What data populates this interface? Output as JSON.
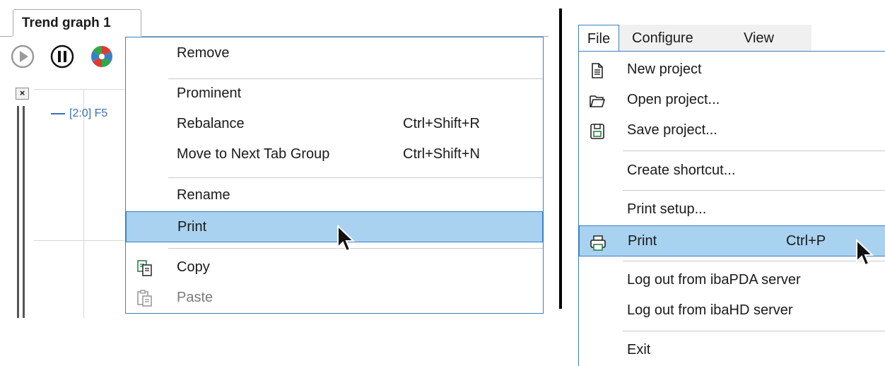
{
  "left_panel": {
    "tab_title": "Trend graph 1",
    "close_glyph": "×",
    "legend_text": "[2:0] F5",
    "toolbar_icons": [
      "play-icon",
      "pause-icon",
      "color-wheel-icon"
    ],
    "context_menu": {
      "items": [
        {
          "label": "Remove",
          "shortcut": ""
        },
        {
          "label": "Prominent",
          "shortcut": ""
        },
        {
          "label": "Rebalance",
          "shortcut": "Ctrl+Shift+R"
        },
        {
          "label": "Move to Next Tab Group",
          "shortcut": "Ctrl+Shift+N"
        },
        {
          "label": "Rename",
          "shortcut": ""
        },
        {
          "label": "Print",
          "shortcut": "",
          "highlighted": true
        },
        {
          "label": "Copy",
          "shortcut": "",
          "icon": "copy-icon"
        },
        {
          "label": "Paste",
          "shortcut": "",
          "icon": "paste-icon",
          "disabled": true
        }
      ]
    }
  },
  "right_panel": {
    "menubar": {
      "file": "File",
      "configure": "Configure",
      "view": "View"
    },
    "file_menu": {
      "items": [
        {
          "label": "New project",
          "shortcut": "",
          "icon": "new-document-icon"
        },
        {
          "label": "Open project...",
          "shortcut": "",
          "icon": "open-folder-icon"
        },
        {
          "label": "Save project...",
          "shortcut": "",
          "icon": "save-icon"
        },
        {
          "label": "Create shortcut...",
          "shortcut": ""
        },
        {
          "label": "Print setup...",
          "shortcut": ""
        },
        {
          "label": "Print",
          "shortcut": "Ctrl+P",
          "icon": "printer-icon",
          "highlighted": true
        },
        {
          "label": "Log out from ibaPDA server",
          "shortcut": ""
        },
        {
          "label": "Log out from ibaHD server",
          "shortcut": ""
        },
        {
          "label": "Exit",
          "shortcut": ""
        }
      ]
    }
  },
  "colors": {
    "highlight": "#a8d2f0",
    "menu_border": "#3c7fc4",
    "legend_blue": "#3a6fb2"
  }
}
